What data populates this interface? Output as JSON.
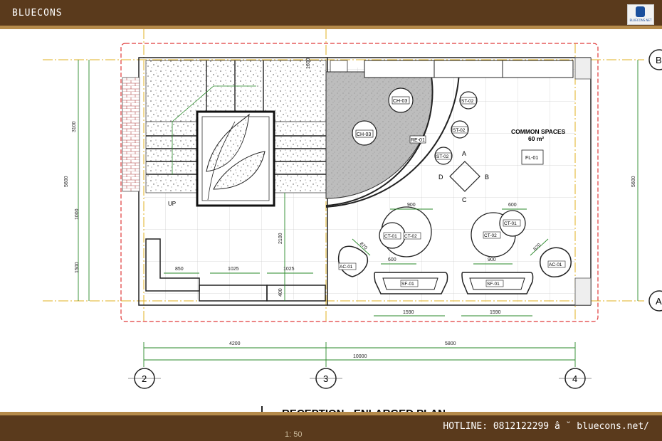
{
  "header": {
    "brand": "BLUECONS",
    "logo_caption": "BLUECONS.NET"
  },
  "footer": {
    "hotline": "HOTLINE: 0812122299  â ˘  bluecons.net/"
  },
  "plan": {
    "room_name": "COMMON SPACES",
    "room_area": "60 m²",
    "stair_label": "UP",
    "title": "RECEPTION - ENLARGED PLAN",
    "scale": "1: 50",
    "grid_left": [
      "2",
      "3",
      "4"
    ],
    "grid_right": [
      "B",
      "A"
    ],
    "tags": {
      "ch1": "CH-03",
      "ch2": "CH-03",
      "re": "RE-01",
      "st1": "ST-02",
      "st2": "ST-02",
      "st3": "ST-02",
      "fl": "FL-01",
      "ct1": "CT-01",
      "ct2": "CT-02",
      "ct3": "CT-02",
      "ct4": "CT-01",
      "ac1": "AC-01",
      "ac2": "AC-01",
      "sf1": "SF-01",
      "sf2": "SF-01"
    },
    "points": [
      "A",
      "B",
      "C",
      "D"
    ],
    "dims": {
      "d3100": "3100",
      "d5600": "5600",
      "d1000": "1000",
      "d1500": "1500",
      "d5600r": "5600",
      "d2100": "2100",
      "d400": "400",
      "d850": "850",
      "d1025a": "1025",
      "d1025b": "1025",
      "d900a": "900",
      "d600a": "600",
      "d600b": "600",
      "d900b": "900",
      "d870a": "870",
      "d870b": "870",
      "d600c": "600",
      "d900c": "900",
      "d1590a": "1590",
      "d1590b": "1590",
      "d4200": "4200",
      "d5800": "5800",
      "d10000": "10000",
      "d1600": "1600"
    }
  }
}
